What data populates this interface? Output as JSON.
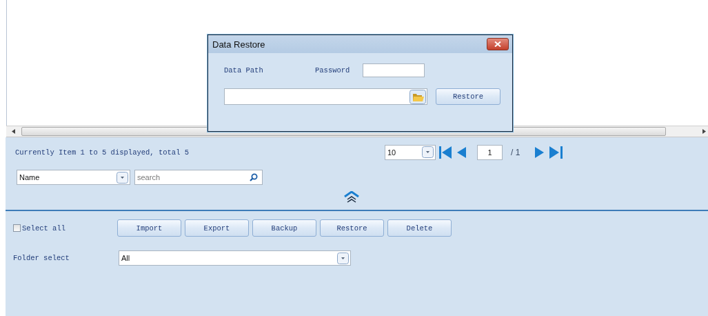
{
  "dialog": {
    "title": "Data Restore",
    "data_path_label": "Data Path",
    "password_label": "Password",
    "restore_button": "Restore"
  },
  "pager": {
    "summary": "Currently Item 1 to 5 displayed, total 5",
    "page_size": "10",
    "page": "1",
    "page_total": "/ 1"
  },
  "search": {
    "field": "Name",
    "placeholder": "search"
  },
  "actions": {
    "select_all": {
      "label": "Select all",
      "checked": false
    },
    "buttons": [
      "Import",
      "Export",
      "Backup",
      "Restore",
      "Delete"
    ],
    "folder_label": "Folder select",
    "folder_value": "All"
  }
}
